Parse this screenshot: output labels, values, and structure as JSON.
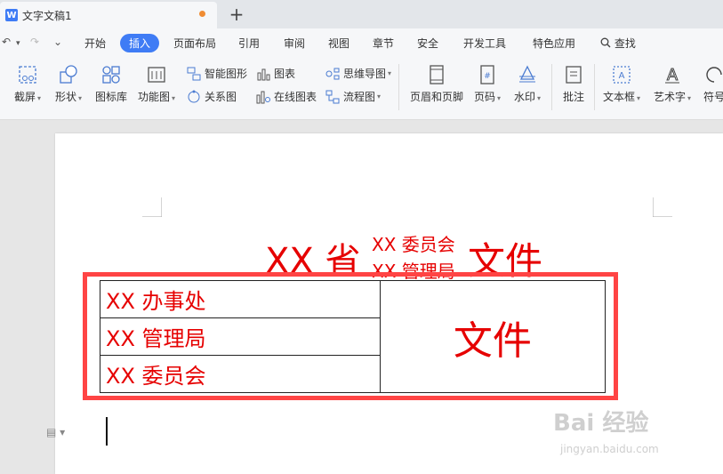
{
  "titlebar": {
    "app_icon": "W",
    "tab_title": "文字文稿1",
    "new_tab": "+"
  },
  "quick": {
    "undo": "↶",
    "redo": "↷",
    "more": "⌄"
  },
  "menu": {
    "items": [
      "开始",
      "插入",
      "页面布局",
      "引用",
      "审阅",
      "视图",
      "章节",
      "安全",
      "开发工具",
      "特色应用"
    ],
    "search_label": "查找"
  },
  "ribbon": {
    "screenshot": "截屏",
    "shape": "形状",
    "icon_lib": "图标库",
    "func_chart": "功能图",
    "smart_shape": "智能图形",
    "chart": "图表",
    "mind_map": "思维导图",
    "relation": "关系图",
    "online_chart": "在线图表",
    "flowchart": "流程图",
    "header_footer": "页眉和页脚",
    "page_num": "页码",
    "watermark": "水印",
    "comment": "批注",
    "textbox": "文本框",
    "wordart": "艺术字",
    "symbol": "符号"
  },
  "document": {
    "title_prefix": "XX 省",
    "title_stack_top": "XX 委员会",
    "title_stack_bottom": "XX 管理局",
    "title_suffix": "文件",
    "rows": [
      "XX 办事处",
      "XX 管理局",
      "XX 委员会"
    ],
    "right_cell": "文件"
  },
  "watermark": {
    "main": "Bai 经验",
    "sub": "jingyan.baidu.com"
  },
  "colors": {
    "accent": "#3f7cf5",
    "doc_red": "#e60000",
    "frame_red": "#ff4444"
  }
}
